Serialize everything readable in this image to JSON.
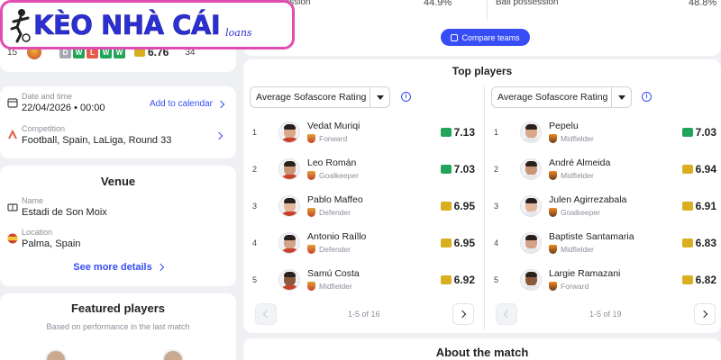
{
  "logo": {
    "text": "KÈO NHÀ CÁI",
    "sub": "loans"
  },
  "form_row": {
    "position": "15",
    "results": [
      "D",
      "W",
      "L",
      "W",
      "W"
    ],
    "rating": "6.76",
    "value2": "34"
  },
  "match_info": {
    "date_label": "Date and time",
    "date_value": "22/04/2026  •  00:00",
    "add_calendar": "Add to calendar",
    "competition_label": "Competition",
    "competition_value": "Football, Spain, LaLiga, Round 33"
  },
  "venue": {
    "title": "Venue",
    "name_label": "Name",
    "name_value": "Estadi de Son Moix",
    "location_label": "Location",
    "location_value": "Palma, Spain",
    "see_more": "See more details"
  },
  "featured": {
    "title": "Featured players",
    "subtitle": "Based on performance in the last match"
  },
  "stats": {
    "left_label": "Ball possession",
    "left_value": "44.9%",
    "right_label": "Ball possession",
    "right_value": "48.8%",
    "compare_button": "Compare teams"
  },
  "top_players": {
    "title": "Top players",
    "left": {
      "dropdown": "Average Sofascore Rating",
      "pagination": "1-5 of 16",
      "players": [
        {
          "rank": "1",
          "name": "Vedat Muriqi",
          "position": "Forward",
          "rating": "7.13",
          "rating_color": "#22a55b"
        },
        {
          "rank": "2",
          "name": "Leo Román",
          "position": "Goalkeeper",
          "rating": "7.03",
          "rating_color": "#22a55b"
        },
        {
          "rank": "3",
          "name": "Pablo Maffeo",
          "position": "Defender",
          "rating": "6.95",
          "rating_color": "#d9af1f"
        },
        {
          "rank": "4",
          "name": "Antonio Raíllo",
          "position": "Defender",
          "rating": "6.95",
          "rating_color": "#d9af1f"
        },
        {
          "rank": "5",
          "name": "Samú Costa",
          "position": "Midfielder",
          "rating": "6.92",
          "rating_color": "#d9af1f"
        }
      ]
    },
    "right": {
      "dropdown": "Average Sofascore Rating",
      "pagination": "1-5 of 19",
      "players": [
        {
          "rank": "1",
          "name": "Pepelu",
          "position": "Midfielder",
          "rating": "7.03",
          "rating_color": "#22a55b"
        },
        {
          "rank": "2",
          "name": "André Almeida",
          "position": "Midfielder",
          "rating": "6.94",
          "rating_color": "#d9af1f"
        },
        {
          "rank": "3",
          "name": "Julen Agirrezabala",
          "position": "Goalkeeper",
          "rating": "6.91",
          "rating_color": "#d9af1f"
        },
        {
          "rank": "4",
          "name": "Baptiste Santamaria",
          "position": "Midfielder",
          "rating": "6.83",
          "rating_color": "#d9af1f"
        },
        {
          "rank": "5",
          "name": "Largie Ramazani",
          "position": "Forward",
          "rating": "6.82",
          "rating_color": "#d9af1f"
        }
      ]
    }
  },
  "about": {
    "title": "About the match"
  },
  "colors": {
    "accent": "#374df5",
    "rating_green": "#22a55b",
    "rating_yellow": "#d9af1f",
    "logo_pink": "#e04db0",
    "logo_blue": "#2c2fd1"
  }
}
